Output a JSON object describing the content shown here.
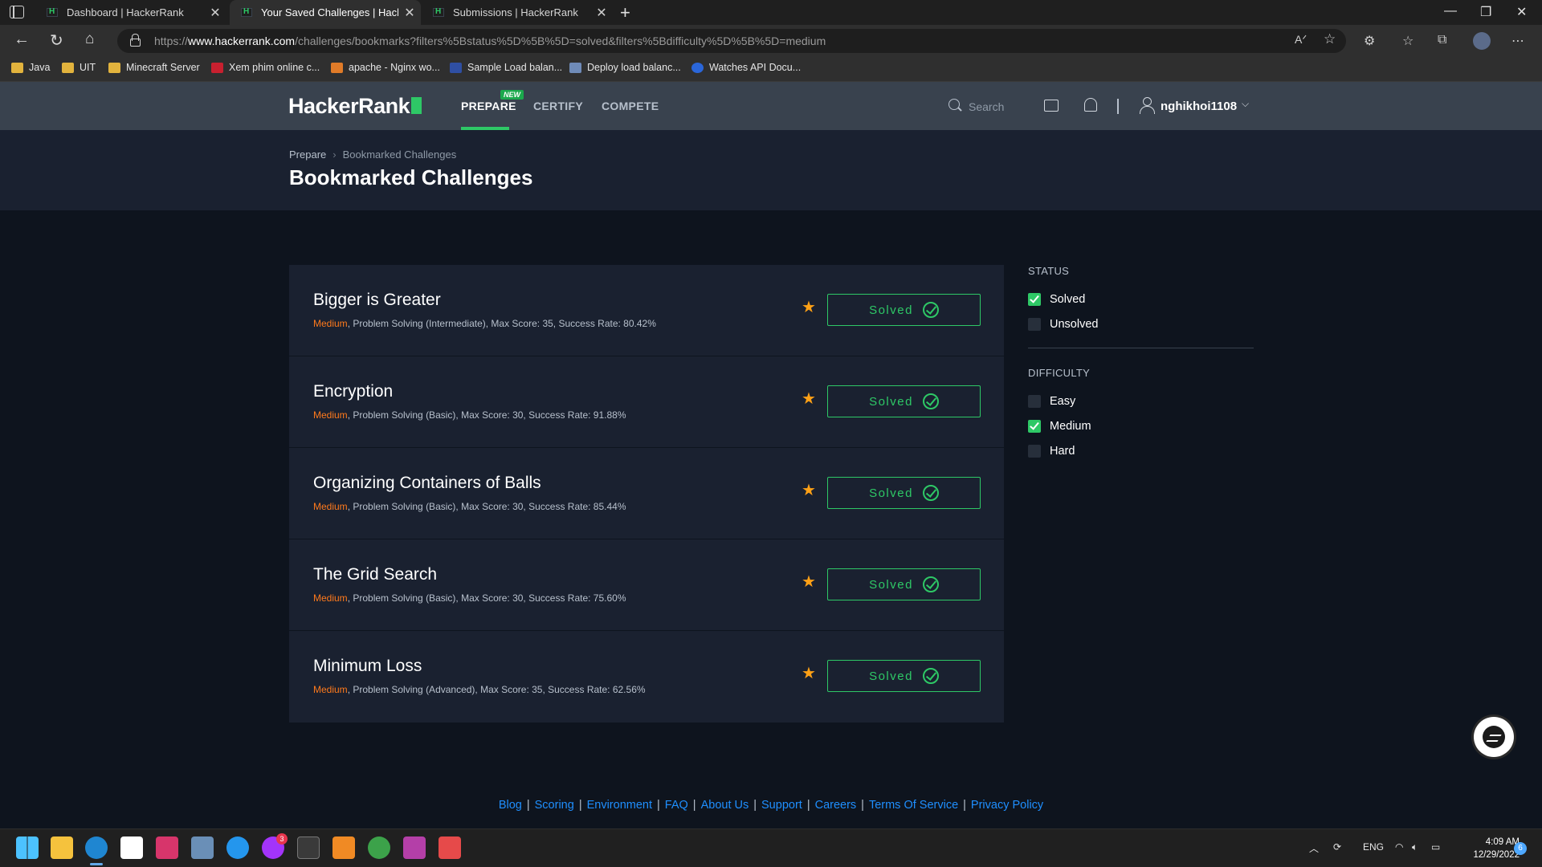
{
  "browser": {
    "tabs": [
      {
        "title": "Dashboard | HackerRank"
      },
      {
        "title": "Your Saved Challenges | HackerRank"
      },
      {
        "title": "Submissions | HackerRank"
      }
    ],
    "url_prefix": "https://",
    "url_host": "www.hackerrank.com",
    "url_path": "/challenges/bookmarks?filters%5Bstatus%5D%5B%5D=solved&filters%5Bdifficulty%5D%5B%5D=medium",
    "bookmarks": [
      {
        "label": "Java",
        "icon": "folder-icon"
      },
      {
        "label": "UIT",
        "icon": "folder-icon"
      },
      {
        "label": "Minecraft Server",
        "icon": "folder-icon"
      },
      {
        "label": "Xem phim online c...",
        "icon": "xp-icon"
      },
      {
        "label": "apache - Nginx wo...",
        "icon": "stack-icon"
      },
      {
        "label": "Sample Load balan...",
        "icon": "site-icon"
      },
      {
        "label": "Deploy load balanc...",
        "icon": "site-icon"
      },
      {
        "label": "Watches API Docu...",
        "icon": "site-icon"
      }
    ]
  },
  "header": {
    "logo": "HackerRank",
    "nav": [
      {
        "label": "PREPARE"
      },
      {
        "label": "CERTIFY"
      },
      {
        "label": "COMPETE"
      }
    ],
    "new_badge": "NEW",
    "search_placeholder": "Search",
    "username": "nghikhoi1108"
  },
  "page": {
    "breadcrumb": [
      "Prepare",
      "Bookmarked Challenges"
    ],
    "title": "Bookmarked Challenges"
  },
  "challenges": [
    {
      "title": "Bigger is Greater",
      "difficulty": "Medium",
      "meta": ", Problem Solving (Intermediate), Max Score: 35, Success Rate: 80.42%",
      "status": "Solved"
    },
    {
      "title": "Encryption",
      "difficulty": "Medium",
      "meta": ", Problem Solving (Basic), Max Score: 30, Success Rate: 91.88%",
      "status": "Solved"
    },
    {
      "title": "Organizing Containers of Balls",
      "difficulty": "Medium",
      "meta": ", Problem Solving (Basic), Max Score: 30, Success Rate: 85.44%",
      "status": "Solved"
    },
    {
      "title": "The Grid Search",
      "difficulty": "Medium",
      "meta": ", Problem Solving (Basic), Max Score: 30, Success Rate: 75.60%",
      "status": "Solved"
    },
    {
      "title": "Minimum Loss",
      "difficulty": "Medium",
      "meta": ", Problem Solving (Advanced), Max Score: 35, Success Rate: 62.56%",
      "status": "Solved"
    }
  ],
  "filters": {
    "status": {
      "heading": "STATUS",
      "options": [
        {
          "label": "Solved",
          "checked": true
        },
        {
          "label": "Unsolved",
          "checked": false
        }
      ]
    },
    "difficulty": {
      "heading": "DIFFICULTY",
      "options": [
        {
          "label": "Easy",
          "checked": false
        },
        {
          "label": "Medium",
          "checked": true
        },
        {
          "label": "Hard",
          "checked": false
        }
      ]
    }
  },
  "footer": {
    "links": [
      "Blog",
      "Scoring",
      "Environment",
      "FAQ",
      "About Us",
      "Support",
      "Careers",
      "Terms Of Service",
      "Privacy Policy"
    ]
  },
  "taskbar": {
    "language": "ENG",
    "time": "4:09 AM",
    "date": "12/29/2022",
    "notification_count": "6",
    "messenger_badge": "3"
  },
  "colors": {
    "brand_green": "#2ec866",
    "difficulty_medium": "#ff7a1c",
    "star": "#ffa116",
    "link": "#1f8fff",
    "header_bg": "#39424e",
    "page_bg": "#0e141e"
  }
}
